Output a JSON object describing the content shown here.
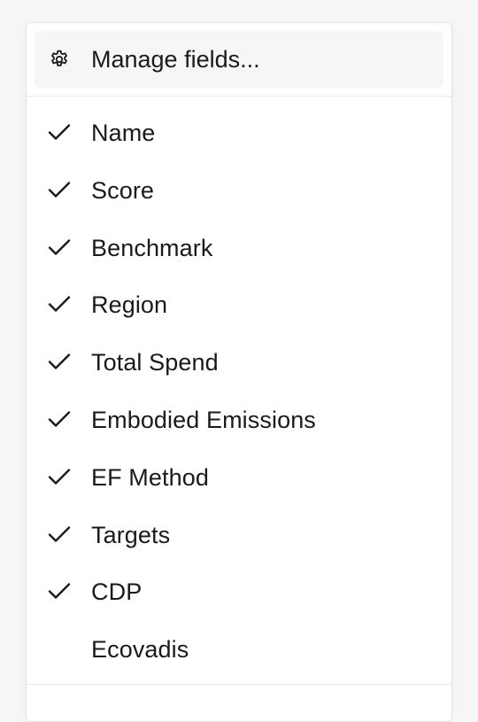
{
  "menu": {
    "manage": {
      "label": "Manage fields...",
      "icon": "gear-icon"
    },
    "fields": [
      {
        "label": "Name",
        "checked": true
      },
      {
        "label": "Score",
        "checked": true
      },
      {
        "label": "Benchmark",
        "checked": true
      },
      {
        "label": "Region",
        "checked": true
      },
      {
        "label": "Total Spend",
        "checked": true
      },
      {
        "label": "Embodied Emissions",
        "checked": true
      },
      {
        "label": "EF Method",
        "checked": true
      },
      {
        "label": "Targets",
        "checked": true
      },
      {
        "label": "CDP",
        "checked": true
      },
      {
        "label": "Ecovadis",
        "checked": false
      }
    ]
  },
  "colors": {
    "background": "#f6f6f7",
    "menu_background": "#ffffff",
    "hover_background": "#f6f6f7",
    "text": "#1a1a1a",
    "border": "#e4e4e7"
  }
}
